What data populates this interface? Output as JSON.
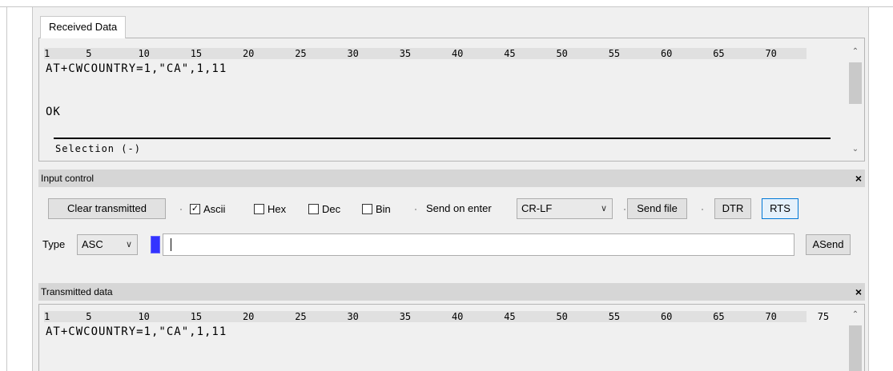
{
  "received": {
    "tab_label": "Received Data",
    "ruler": [
      "1",
      "5",
      "10",
      "15",
      "20",
      "25",
      "30",
      "35",
      "40",
      "45",
      "50",
      "55",
      "60",
      "65",
      "70"
    ],
    "lines": [
      "AT+CWCOUNTRY=1,\"CA\",1,11",
      "",
      "OK"
    ],
    "selection_label": "Selection (-)"
  },
  "input_control": {
    "title": "Input control",
    "close_glyph": "×",
    "clear_button": "Clear transmitted",
    "checkboxes": [
      {
        "label": "Ascii",
        "checked": true
      },
      {
        "label": "Hex",
        "checked": false
      },
      {
        "label": "Dec",
        "checked": false
      },
      {
        "label": "Bin",
        "checked": false
      }
    ],
    "send_on_enter_label": "Send on enter",
    "send_on_enter_value": "CR-LF",
    "send_file_button": "Send file",
    "dtr_button": "DTR",
    "rts_button": "RTS",
    "type_label": "Type",
    "type_value": "ASC",
    "input_value": "",
    "asend_button": "ASend"
  },
  "transmitted": {
    "title": "Transmitted data",
    "close_glyph": "×",
    "ruler": [
      "1",
      "5",
      "10",
      "15",
      "20",
      "25",
      "30",
      "35",
      "40",
      "45",
      "50",
      "55",
      "60",
      "65",
      "70",
      "75"
    ],
    "lines": [
      "AT+CWCOUNTRY=1,\"CA\",1,11"
    ]
  },
  "colors": {
    "accent": "#0078d7",
    "marker_blue": "#3333ff"
  },
  "icons": {
    "scroll_up": "▲",
    "scroll_down": "▼",
    "chevron": "﹀"
  }
}
